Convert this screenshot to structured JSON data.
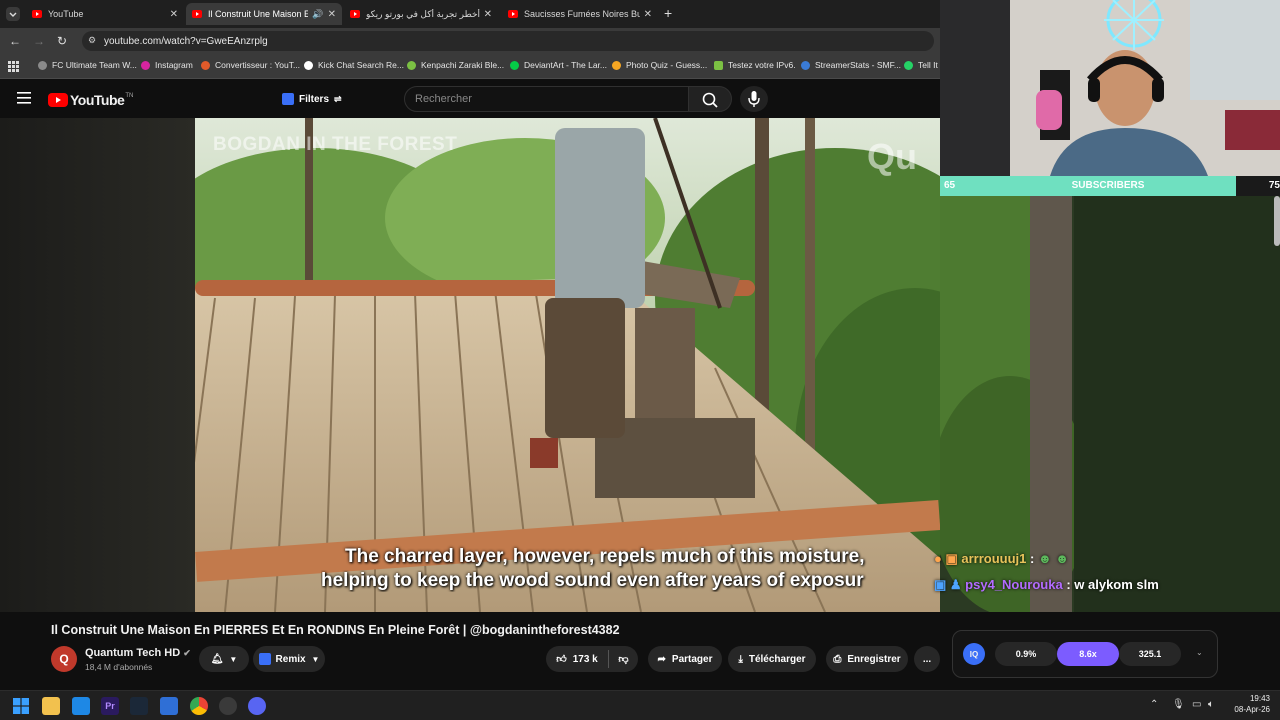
{
  "browser": {
    "tabs": [
      {
        "title": "YouTube",
        "active": false
      },
      {
        "title": "Il Construit Une Maison En",
        "active": true
      },
      {
        "title": "أخطر تجربة أكل في بورتو ريكو...",
        "active": false
      },
      {
        "title": "Saucisses Fumées Noires Bushi",
        "active": false
      }
    ],
    "new_tab": "+",
    "url": "youtube.com/watch?v=GweEAnzrplg",
    "bookmarks": [
      {
        "label": "FC Ultimate Team W...",
        "color": "#8a8a8a"
      },
      {
        "label": "Instagram",
        "color": "#d6249f"
      },
      {
        "label": "Convertisseur : YouT...",
        "color": "#e05a2a"
      },
      {
        "label": "Kick Chat Search Re...",
        "color": "#ffffff"
      },
      {
        "label": "Kenpachi Zaraki Ble...",
        "color": "#7bc043"
      },
      {
        "label": "DeviantArt - The Lar...",
        "color": "#05cc47"
      },
      {
        "label": "Photo Quiz - Guess...",
        "color": "#f5a623"
      },
      {
        "label": "Testez votre IPv6.",
        "color": "#7bc043"
      },
      {
        "label": "StreamerStats - SMF...",
        "color": "#3a7bd5"
      },
      {
        "label": "Tell It",
        "color": "#25d366"
      }
    ]
  },
  "youtube": {
    "logo_text": "YouTube",
    "logo_suffix": "TN",
    "filters_label": "Filters",
    "search_placeholder": "Rechercher"
  },
  "video": {
    "watermark_left": "BOGDAN IN THE FOREST",
    "watermark_right": "Qu",
    "captions": [
      "The charred layer, however, repels much of this moisture,",
      "helping to keep the wood sound even after years of exposur"
    ]
  },
  "stream_overlay": {
    "subs_current": "65",
    "subs_label": "SUBSCRIBERS",
    "subs_goal": "75",
    "subs_progress": 0.87,
    "chat": [
      {
        "user": "arrrouuuj1",
        "text": ":",
        "color": "#e8c35a"
      },
      {
        "user": "psy4_Nourouka",
        "text": ": w alykom slm",
        "color": "#b36bff"
      }
    ]
  },
  "video_info": {
    "title": "Il Construit Une Maison En PIERRES Et En RONDINS En Pleine Forêt | @bogdanintheforest4382",
    "channel": "Quantum Tech HD",
    "subscribers": "18,4 M d'abonnés",
    "remix_label": "Remix",
    "likes": "173 k",
    "share_label": "Partager",
    "download_label": "Télécharger",
    "save_label": "Enregistrer",
    "more_label": "...",
    "ext_badge": "IQ",
    "ext_stats": [
      "0.9%",
      "8.6x",
      "325.1"
    ]
  },
  "taskbar": {
    "time": "19:43",
    "date": "08-Apr-26"
  },
  "colors": {
    "accent_red": "#ff0000",
    "subs_bar": "#6fe0c0",
    "ext_purple": "#7c5cff"
  }
}
